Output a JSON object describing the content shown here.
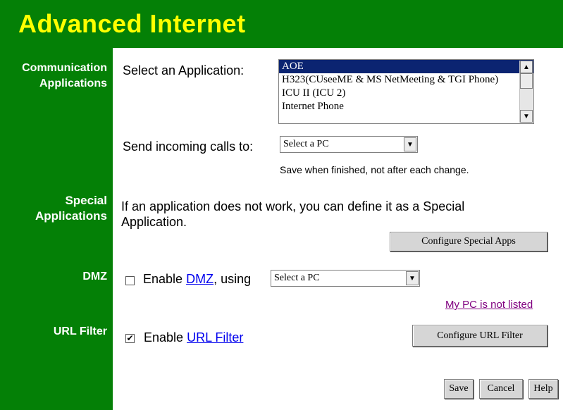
{
  "header": {
    "title": "Advanced Internet"
  },
  "sections": {
    "comm": {
      "line1": "Communication",
      "line2": "Applications"
    },
    "special": {
      "line1": "Special",
      "line2": "Applications"
    },
    "dmz": {
      "label": "DMZ"
    },
    "url_filter": {
      "label": "URL Filter"
    }
  },
  "communication": {
    "select_app_label": "Select an Application:",
    "applications": [
      "AOE",
      "H323(CUseeME & MS NetMeeting & TGI Phone)",
      "ICU II (ICU 2)",
      "Internet Phone"
    ],
    "selected_index": 0,
    "send_calls_label": "Send incoming calls to:",
    "send_calls_value": "Select a PC",
    "save_note": "Save when finished, not after each change."
  },
  "special": {
    "text": "If an application does not work, you can define it as a Special Application.",
    "configure_button": "Configure Special Apps"
  },
  "dmz": {
    "enable_prefix": "Enable",
    "link_text": "DMZ",
    "suffix": ", using",
    "select_value": "Select a PC",
    "checked": false,
    "not_listed_link": "My PC is not listed"
  },
  "url_filter": {
    "enable_prefix": "Enable",
    "link_text": "URL Filter",
    "checked": true,
    "configure_button": "Configure URL Filter"
  },
  "footer": {
    "save": "Save",
    "cancel": "Cancel",
    "help": "Help"
  },
  "colors": {
    "green": "#048006",
    "title_yellow": "#ffff00",
    "selection_blue": "#0b2471"
  }
}
